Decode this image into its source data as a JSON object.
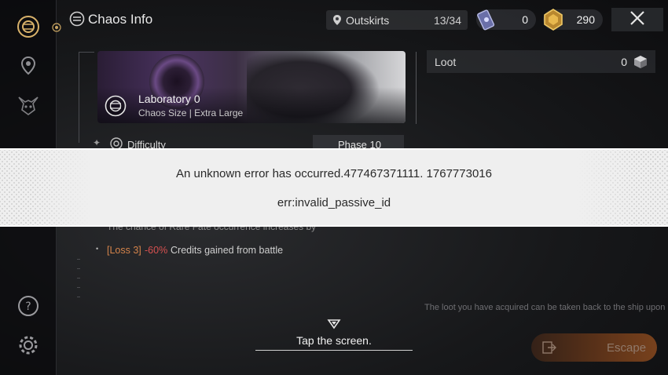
{
  "header": {
    "title": "Chaos Info",
    "location": {
      "name": "Outskirts",
      "progress": "13/34"
    },
    "currencies": [
      {
        "icon": "crystal-ticket-icon",
        "value": "0"
      },
      {
        "icon": "gold-medal-icon",
        "value": "290"
      }
    ]
  },
  "stage": {
    "name": "Laboratory 0",
    "subtitle": "Chaos Size | Extra Large"
  },
  "loot": {
    "label": "Loot",
    "value": "0"
  },
  "difficulty": {
    "label": "Difficulty",
    "phase": "Phase 10"
  },
  "effects": {
    "line1": "The chance of Rare Fate occurrence increases by",
    "item": {
      "tag": "[Loss 3]",
      "percent": "-60%",
      "text": "Credits gained from battle"
    }
  },
  "error": {
    "message": "An unknown error has occurred.477467371111. 1767773016",
    "code": "err:invalid_passive_id"
  },
  "loot_note": "The loot you have acquired can be taken back to the ship upon return.",
  "tap_prompt": "Tap the screen.",
  "escape_label": "Escape",
  "colors": {
    "loss_tag": "#d4834a",
    "loss_percent": "#d65050",
    "escape": "#8a4a1f",
    "error_bg": "#efefef"
  }
}
